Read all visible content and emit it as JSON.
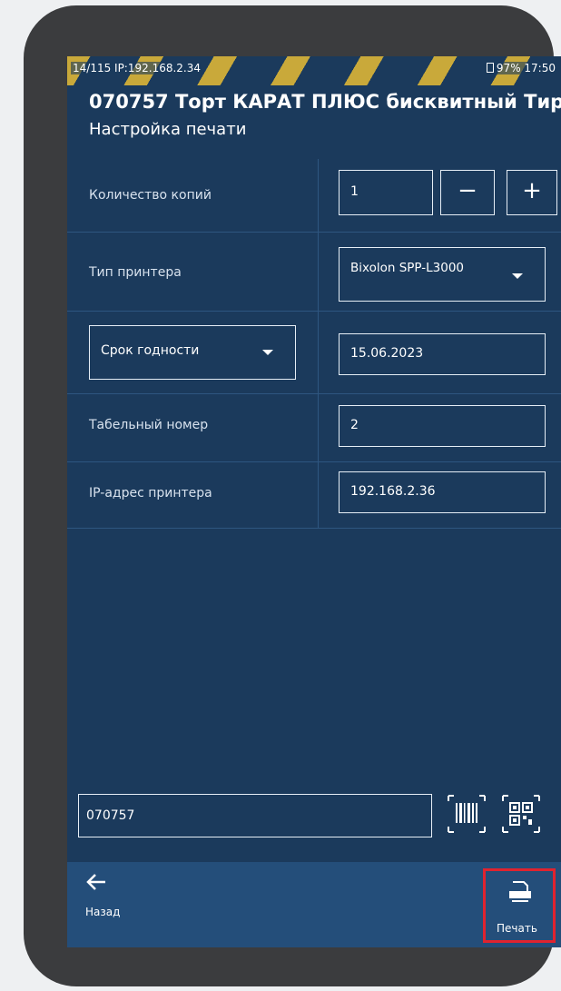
{
  "status_bar": {
    "left_text": "14/115 IP:192.168.2.34",
    "right_text": "97% 17:50"
  },
  "header": {
    "title": "070757 Торт КАРАТ ПЛЮС бисквитный Тир...",
    "subtitle": "Настройка печати"
  },
  "form": {
    "copies": {
      "label": "Количество копий",
      "value": "1",
      "minus": "−",
      "plus": "+"
    },
    "printer_type": {
      "label": "Тип принтера",
      "value": "Bixolon SPP-L3000"
    },
    "date_field": {
      "selector_value": "Срок годности",
      "value": "15.06.2023"
    },
    "employee_number": {
      "label": "Табельный номер",
      "value": "2"
    },
    "printer_ip": {
      "label": "IP-адрес принтера",
      "value": "192.168.2.36"
    }
  },
  "scan": {
    "value": "070757"
  },
  "bottom_nav": {
    "back_label": "Назад",
    "print_label": "Печать"
  },
  "colors": {
    "background": "#1b3a5c",
    "bar": "#244e7a",
    "highlight": "#e0232f",
    "stripe": "#c9a93a"
  },
  "icons": [
    "arrow-left-icon",
    "printer-icon",
    "barcode-icon",
    "qr-code-icon",
    "caret-down-icon"
  ]
}
